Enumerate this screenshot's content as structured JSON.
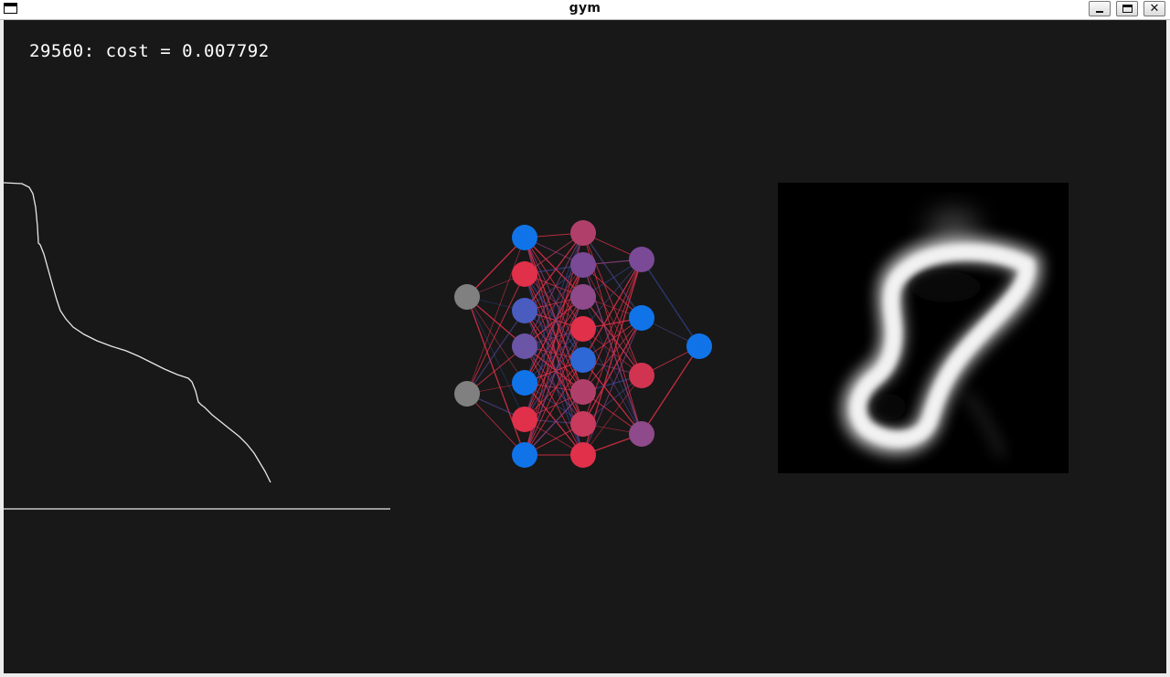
{
  "window": {
    "title": "gym",
    "minimize_label": "_",
    "maximize_label": "",
    "close_label": "✕"
  },
  "status": {
    "epoch": "29560",
    "cost_label": "cost",
    "cost_value": "0.007792",
    "text": "29560: cost = 0.007792"
  },
  "colors": {
    "background": "#181818",
    "text": "#ffffff",
    "negative": "#e0304a",
    "positive": "#1074e8",
    "neutral_input": "#808080",
    "plot_line": "#e8e8e8"
  },
  "network": {
    "layers": [
      [
        "#808080",
        "#808080"
      ],
      [
        "#1074e8",
        "#e0304a",
        "#4a5cc0",
        "#6b55a6",
        "#1074e8",
        "#e0304a",
        "#1074e8"
      ],
      [
        "#b0406a",
        "#7a4a96",
        "#8e4a8a",
        "#e0304a",
        "#2e68d6",
        "#b0406a",
        "#c93a5c",
        "#e0304a"
      ],
      [
        "#7a4a96",
        "#1074e8",
        "#d13450",
        "#8e4a8a"
      ],
      [
        "#1074e8"
      ]
    ]
  }
}
